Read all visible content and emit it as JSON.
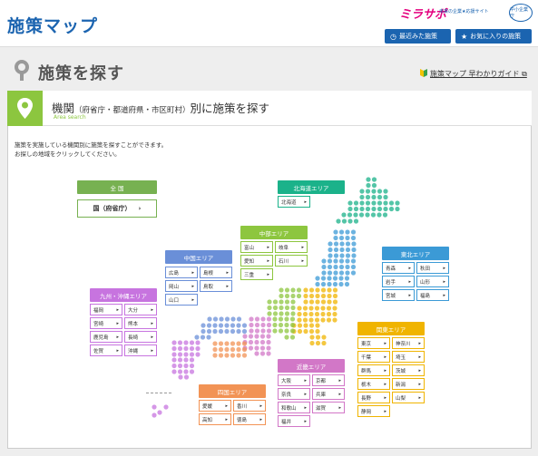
{
  "header": {
    "title": "施策マップ",
    "logo_text": "ミラサポ",
    "logo_sub": "未来の企業★応援サイト",
    "badge_text": "中小企業庁",
    "recent_label": "最近みた施策",
    "fav_label": "お気に入りの施策"
  },
  "page": {
    "title": "施策を探す",
    "guide_label": "施策マップ 早わかりガイド"
  },
  "card": {
    "title_main": "機関",
    "title_paren": "（府省庁・都道府県・市区町村）",
    "title_tail": "別に施策を探す",
    "subtitle": "Area search",
    "desc_line1": "施策を実施している機関別に施策を探すことができます。",
    "desc_line2": "お探しの地域をクリックしてください。"
  },
  "national": {
    "label": "全 国",
    "button": "国（府省庁）"
  },
  "regions": {
    "hokkaido": {
      "label": "北海道エリア",
      "prefs": [
        "北海道"
      ]
    },
    "tohoku": {
      "label": "東北エリア",
      "prefs": [
        "青森",
        "秋田",
        "岩手",
        "山形",
        "宮城",
        "福島"
      ]
    },
    "chubu": {
      "label": "中部エリア",
      "prefs": [
        "富山",
        "岐阜",
        "愛知",
        "石川",
        "三重"
      ]
    },
    "chugoku": {
      "label": "中国エリア",
      "prefs": [
        "広島",
        "島根",
        "岡山",
        "鳥取",
        "山口"
      ]
    },
    "kyushu": {
      "label": "九州・沖縄エリア",
      "prefs": [
        "福岡",
        "大分",
        "宮崎",
        "熊本",
        "鹿児島",
        "長崎",
        "佐賀",
        "沖縄"
      ]
    },
    "kanto": {
      "label": "関東エリア",
      "prefs": [
        "東京",
        "神奈川",
        "千葉",
        "埼玉",
        "群馬",
        "茨城",
        "栃木",
        "新潟",
        "長野",
        "山梨",
        "静岡"
      ]
    },
    "kinki": {
      "label": "近畿エリア",
      "prefs": [
        "大阪",
        "京都",
        "奈良",
        "兵庫",
        "和歌山",
        "滋賀",
        "福井"
      ]
    },
    "shikoku": {
      "label": "四国エリア",
      "prefs": [
        "愛媛",
        "香川",
        "高知",
        "徳島"
      ]
    }
  },
  "colors": {
    "brand_blue": "#1b64b0",
    "national": "#77b151",
    "hokkaido": "#1bb28a",
    "tohoku": "#3b9ad6",
    "chubu": "#8dc63f",
    "chugoku": "#6a8fd8",
    "kyushu": "#c774df",
    "kanto": "#f0b400",
    "kinki": "#d277c7",
    "shikoku": "#f29355"
  },
  "icons": {
    "recent": "clock-icon",
    "fav": "star-icon",
    "pin": "map-pin-icon",
    "search": "magnifier-icon",
    "guide": "beginner-mark-icon",
    "external": "external-link-icon"
  }
}
